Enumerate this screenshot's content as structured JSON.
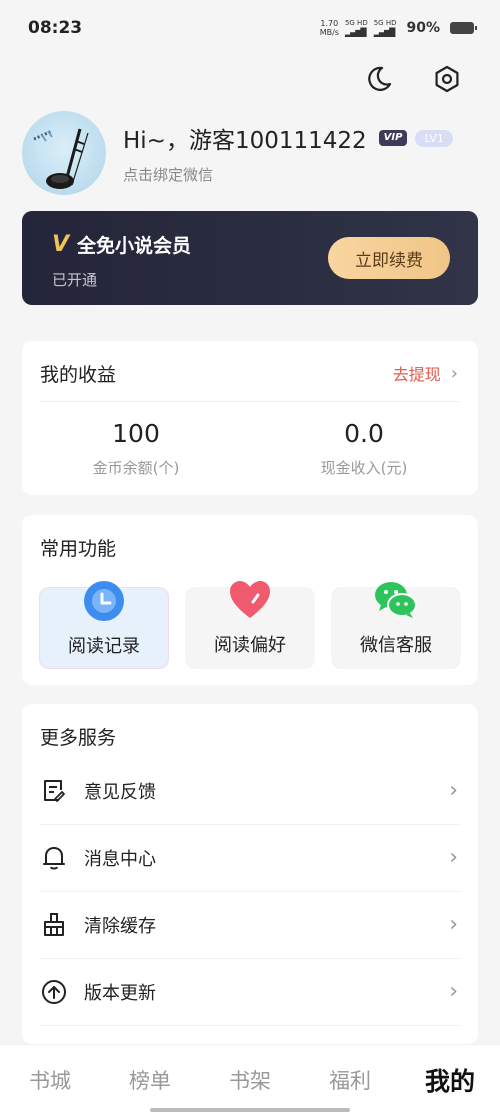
{
  "status_bar": {
    "time": "08:23",
    "net_speed": "1.70",
    "net_unit": "MB/s",
    "sim1": "5G HD",
    "sim2": "5G HD",
    "battery": "90%"
  },
  "top_icons": [
    "moon-icon",
    "settings-hex-icon"
  ],
  "profile": {
    "greeting": "Hi~，游客100111422",
    "vip_badge": "VIP",
    "level": "LV1",
    "bind_hint": "点击绑定微信"
  },
  "vip_card": {
    "logo": "V",
    "title": "全免小说会员",
    "status": "已开通",
    "renew_label": "立即续费",
    "accent": "#f1c15b"
  },
  "earnings": {
    "title": "我的收益",
    "withdraw_label": "去提现",
    "coin_value": "100",
    "coin_label": "金币余额(个)",
    "cash_value": "0.0",
    "cash_label": "现金收入(元)",
    "withdraw_color": "#e25b4a"
  },
  "functions": {
    "title": "常用功能",
    "items": [
      {
        "label": "阅读记录",
        "icon": "clock-icon"
      },
      {
        "label": "阅读偏好",
        "icon": "heart-icon"
      },
      {
        "label": "微信客服",
        "icon": "wechat-icon"
      }
    ]
  },
  "services": {
    "title": "更多服务",
    "items": [
      {
        "label": "意见反馈",
        "icon": "feedback-icon"
      },
      {
        "label": "消息中心",
        "icon": "bell-icon"
      },
      {
        "label": "清除缓存",
        "icon": "broom-icon"
      },
      {
        "label": "版本更新",
        "icon": "upload-cloud-icon"
      }
    ]
  },
  "bottom_nav": {
    "items": [
      "书城",
      "榜单",
      "书架",
      "福利",
      "我的"
    ],
    "active": "我的"
  }
}
